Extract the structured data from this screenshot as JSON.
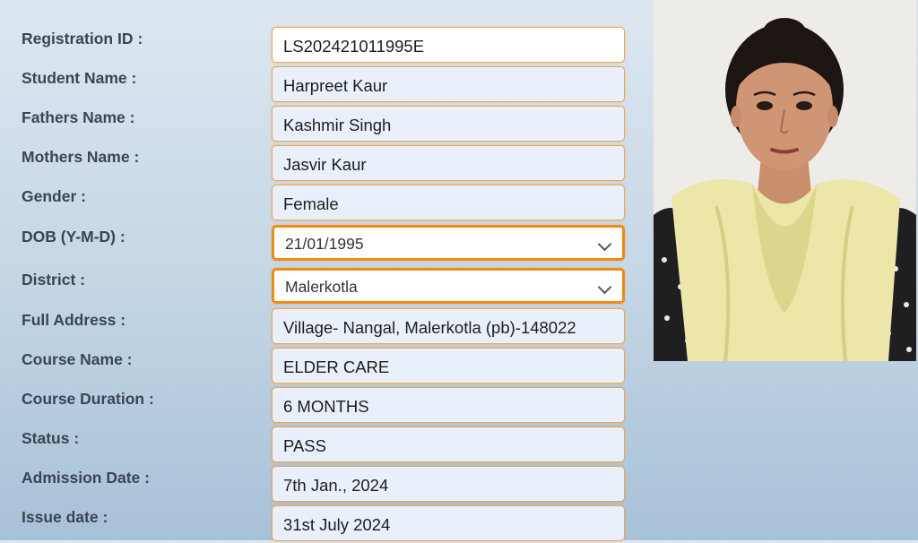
{
  "fields": [
    {
      "label": "Registration ID :",
      "value": "LS202421011995E"
    },
    {
      "label": "Student Name :",
      "value": "Harpreet Kaur"
    },
    {
      "label": "Fathers Name :",
      "value": "Kashmir Singh"
    },
    {
      "label": "Mothers Name :",
      "value": "Jasvir Kaur"
    },
    {
      "label": "Gender :",
      "value": "Female"
    },
    {
      "label": "DOB (Y-M-D) :",
      "value": "21/01/1995"
    },
    {
      "label": "District :",
      "value": "Malerkotla"
    },
    {
      "label": "Full Address :",
      "value": "Village- Nangal, Malerkotla (pb)-148022"
    },
    {
      "label": "Course Name :",
      "value": "ELDER CARE"
    },
    {
      "label": "Course Duration :",
      "value": "6 MONTHS"
    },
    {
      "label": "Status :",
      "value": "PASS"
    },
    {
      "label": "Admission Date :",
      "value": "7th Jan., 2024"
    },
    {
      "label": "Issue date :",
      "value": "31st July 2024"
    }
  ],
  "colors": {
    "field_border": "#f0a64a",
    "select_border": "#f28a10",
    "label_text": "#3b4553"
  },
  "icons": {
    "photo": "student-photo",
    "dropdown": "chevron-down-icon"
  }
}
